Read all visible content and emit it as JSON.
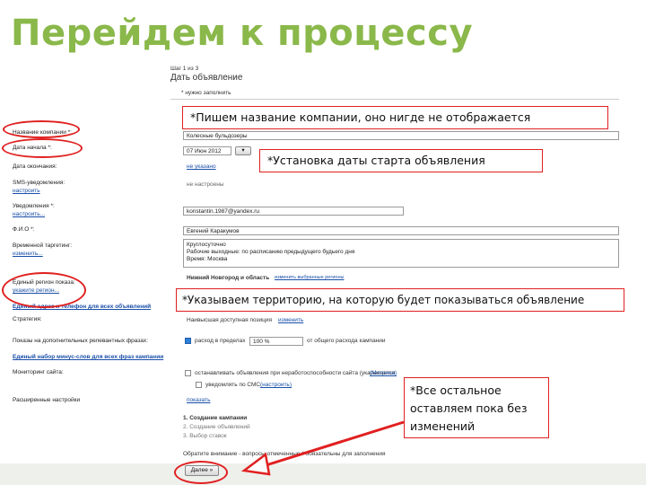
{
  "slide": {
    "title": "Перейдем к процессу"
  },
  "form": {
    "step": "Шаг 1 из 3",
    "header": "Дать объявление",
    "required_note": "* нужно заполнить",
    "fields": {
      "company_name_label": "Название компании *:",
      "company_name_value": "Колесные бульдозеры",
      "start_date_label": "Дата начала *:",
      "start_date_value": "07 Июн 2012",
      "end_date_label": "Дата окончания:",
      "end_date_link": "не указано",
      "sms_label": "SMS-уведомления:",
      "sms_link": "настроить",
      "sms_value": "не настроены",
      "notify_label": "Уведомления *:",
      "notify_link": "настроить...",
      "email_value": "konstantin.1987@yandex.ru",
      "fio_label": "Ф.И.О *:",
      "fio_value": "Евгений Каракумов",
      "schedule_label": "Временной таргетинг:",
      "schedule_link": "изменить...",
      "schedule_lines": [
        "Круглосуточно",
        "Рабочие выходные: по расписанию предыдущего будьего дня",
        "Время: Москва"
      ],
      "region_label": "Единый регион показа:",
      "region_link": "укажите регион...",
      "region_value": "Нижний Новгород и область",
      "region_change_link": "изменить выбранные регионы",
      "address_link": "Единый адрес и телефон для всех объявлений",
      "strategy_label": "Стратегия:",
      "strategy_value": "Наивысшая доступная позиция",
      "strategy_link": "изменить",
      "extra_sites_label": "Показы на дополнительных релевантных фразах:",
      "percent_value": "100 %",
      "percent_prefix": "расход в пределах",
      "percent_suffix": "от общего расхода кампании",
      "negative_link": "Единый набор минус-слов для всех фраз кампании",
      "monitor_label": "Мониторинг сайта:",
      "monitor_option": "останавливать объявления при неработоспособности сайта (указывается",
      "monitor_link": "(Метрика)",
      "notify_sms_option": "уведомлять по СМС",
      "notify_sms_link": "(настроить)",
      "advanced_label": "Расширенные настройки",
      "advanced_link": "показать"
    },
    "steps": [
      "1. Создание кампании",
      "2. Создание объявлений",
      "3. Выбор ставок"
    ],
    "legal_note": "Обратите внимание - вопросы отмеченные * обязательны для заполнения",
    "next_button": "Далее »"
  },
  "callouts": {
    "company": "*Пишем название компании, оно нигде не отображается",
    "date": "*Установка даты старта объявления",
    "region": "*Указываем территорию, на которую будет показываться объявление",
    "rest": "*Все остальное оставляем пока без изменений"
  },
  "colors": {
    "title": "#8ab84a",
    "annotation": "#e02020",
    "link": "#1a4fa8"
  }
}
